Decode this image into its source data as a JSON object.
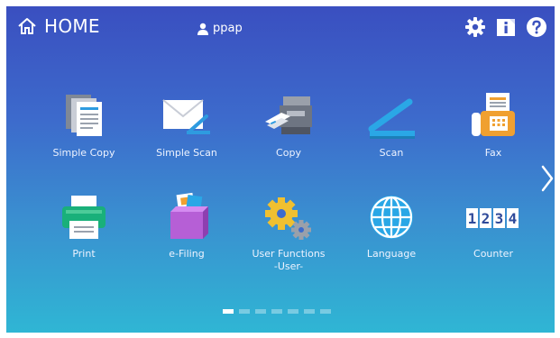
{
  "header": {
    "title": "HOME",
    "user": "ppap"
  },
  "tiles": [
    {
      "label": "Simple Copy",
      "icon": "simple-copy-icon"
    },
    {
      "label": "Simple Scan",
      "icon": "simple-scan-icon"
    },
    {
      "label": "Copy",
      "icon": "copy-icon"
    },
    {
      "label": "Scan",
      "icon": "scan-icon"
    },
    {
      "label": "Fax",
      "icon": "fax-icon"
    },
    {
      "label": "Print",
      "icon": "print-icon"
    },
    {
      "label": "e-Filing",
      "icon": "e-filing-icon"
    },
    {
      "label": "User Functions\n-User-",
      "icon": "user-functions-icon"
    },
    {
      "label": "Language",
      "icon": "language-icon"
    },
    {
      "label": "Counter",
      "icon": "counter-icon"
    }
  ],
  "counter_digits": [
    "1",
    "2",
    "3",
    "4"
  ],
  "pager": {
    "pages": 7,
    "active": 1
  },
  "colors": {
    "bg_top": "#3a4fc0",
    "bg_bottom": "#2fb6d4",
    "accent_blue": "#2aa7e6",
    "accent_orange": "#f0a030",
    "accent_green": "#19b07a"
  }
}
